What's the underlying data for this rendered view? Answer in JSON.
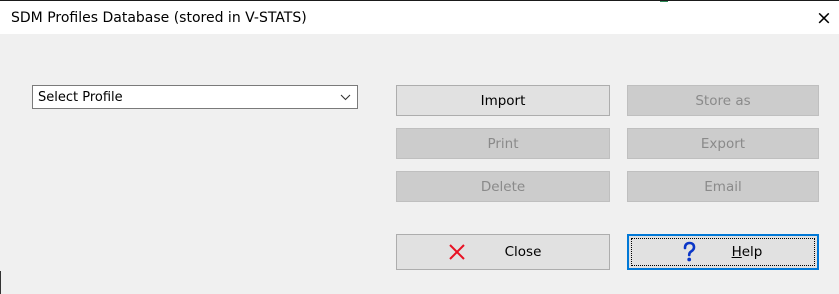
{
  "window": {
    "title": "SDM Profiles Database (stored in V-STATS)",
    "close_glyph": "×"
  },
  "profile_select": {
    "selected": "Select Profile",
    "icon": "chevron-down-icon"
  },
  "buttons": {
    "import": {
      "label": "Import",
      "enabled": true
    },
    "store_as": {
      "label": "Store as",
      "enabled": false
    },
    "print": {
      "label": "Print",
      "enabled": false
    },
    "export": {
      "label": "Export",
      "enabled": false
    },
    "delete": {
      "label": "Delete",
      "enabled": false
    },
    "email": {
      "label": "Email",
      "enabled": false
    },
    "close": {
      "label": "Close",
      "icon": "close-x-icon",
      "icon_color": "#e81123"
    },
    "help": {
      "label_mnemonic": "H",
      "label_rest": "elp",
      "icon": "help-question-icon",
      "icon_color": "#0a36c7"
    }
  }
}
